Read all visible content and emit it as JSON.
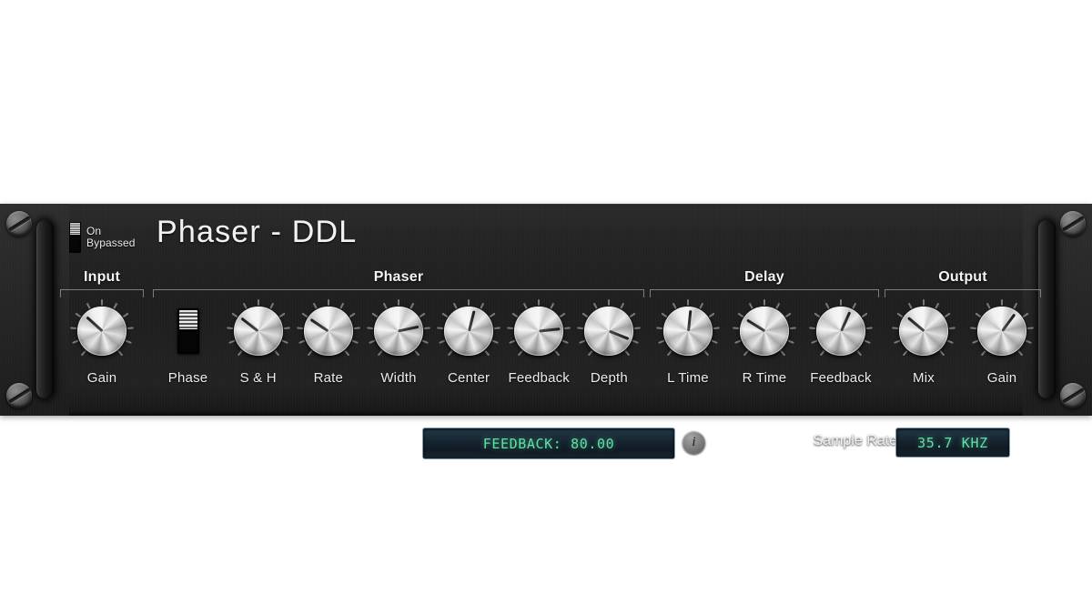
{
  "header": {
    "bypass": {
      "on_label": "On",
      "bypassed_label": "Bypassed",
      "state": "On",
      "switch_icon": "toggle-switch-icon"
    },
    "title": "Phaser - DDL",
    "main_display": "FEEDBACK: 80.00",
    "info_button": "i",
    "sample_rate_label": "Sample Rate",
    "sample_rate_value": "35.7 KHZ"
  },
  "colors": {
    "panel_dark": "#1e1e1e",
    "lcd_text": "#5fe0a6",
    "lcd_border": "#7d9cb4",
    "lcd_bg": "#16242f",
    "label_text": "#ececec",
    "knob_metal": "#d0d0d0"
  },
  "sections": [
    {
      "title": "Input",
      "controls": [
        {
          "label": "Gain",
          "type": "knob",
          "angle": -48
        }
      ]
    },
    {
      "title": "Phaser",
      "controls": [
        {
          "label": "Phase",
          "type": "switch",
          "state": "up"
        },
        {
          "label": "S & H",
          "type": "knob",
          "angle": -52
        },
        {
          "label": "Rate",
          "type": "knob",
          "angle": -56
        },
        {
          "label": "Width",
          "type": "knob",
          "angle": 78
        },
        {
          "label": "Center",
          "type": "knob",
          "angle": 14
        },
        {
          "label": "Feedback",
          "type": "knob",
          "angle": 84
        },
        {
          "label": "Depth",
          "type": "knob",
          "angle": 112
        }
      ]
    },
    {
      "title": "Delay",
      "controls": [
        {
          "label": "L Time",
          "type": "knob",
          "angle": 6
        },
        {
          "label": "R Time",
          "type": "knob",
          "angle": -58
        },
        {
          "label": "Feedback",
          "type": "knob",
          "angle": 24
        }
      ]
    },
    {
      "title": "Output",
      "controls": [
        {
          "label": "Mix",
          "type": "knob",
          "angle": -50
        },
        {
          "label": "Gain",
          "type": "knob",
          "angle": 36
        }
      ]
    }
  ]
}
